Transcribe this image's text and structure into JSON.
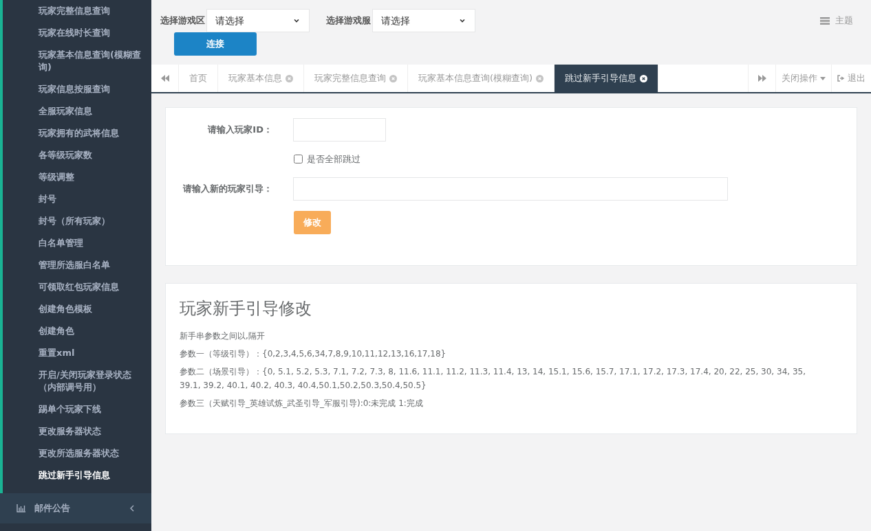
{
  "sidebar": {
    "items": [
      {
        "label": "玩家完整信息查询",
        "selected": false
      },
      {
        "label": "玩家在线时长查询",
        "selected": false
      },
      {
        "label": "玩家基本信息查询(模糊查询)",
        "selected": false
      },
      {
        "label": "玩家信息按服查询",
        "selected": false
      },
      {
        "label": "全服玩家信息",
        "selected": false
      },
      {
        "label": "玩家拥有的武将信息",
        "selected": false
      },
      {
        "label": "各等级玩家数",
        "selected": false
      },
      {
        "label": "等级调整",
        "selected": false
      },
      {
        "label": "封号",
        "selected": false
      },
      {
        "label": "封号（所有玩家）",
        "selected": false
      },
      {
        "label": "白名单管理",
        "selected": false
      },
      {
        "label": "管理所选服白名单",
        "selected": false
      },
      {
        "label": "可领取红包玩家信息",
        "selected": false
      },
      {
        "label": "创建角色模板",
        "selected": false
      },
      {
        "label": "创建角色",
        "selected": false
      },
      {
        "label": "重置xml",
        "selected": false
      },
      {
        "label": "开启/关闭玩家登录状态（内部调号用）",
        "selected": false
      },
      {
        "label": "踢单个玩家下线",
        "selected": false
      },
      {
        "label": "更改服务器状态",
        "selected": false
      },
      {
        "label": "更改所选服务器状态",
        "selected": false
      },
      {
        "label": "跳过新手引导信息",
        "selected": true
      }
    ],
    "section": {
      "label": "邮件公告",
      "expanded": false
    }
  },
  "header": {
    "zone_label": "选择游戏区",
    "zone_value": "请选择",
    "server_label": "选择游戏服",
    "server_value": "请选择",
    "connect_button": "连接",
    "theme": "主题"
  },
  "tabs": [
    {
      "label": "首页",
      "selected": false,
      "closable": false
    },
    {
      "label": "玩家基本信息",
      "selected": false,
      "closable": true
    },
    {
      "label": "玩家完整信息查询",
      "selected": false,
      "closable": true
    },
    {
      "label": "玩家基本信息查询(模糊查询)",
      "selected": false,
      "closable": true
    },
    {
      "label": "跳过新手引导信息",
      "selected": true,
      "closable": true
    }
  ],
  "tab_actions": {
    "close_menu": "关闭操作",
    "logout": "退出"
  },
  "form": {
    "id_label": "请输入玩家ID：",
    "skip_all": {
      "label": "是否全部跳过",
      "checked": false
    },
    "guide_label": "请输入新的玩家引导：",
    "submit": "修改"
  },
  "info": {
    "title": "玩家新手引导修改",
    "lines": [
      "新手串参数之间以,隔开",
      "参数一（等级引导）：{0,2,3,4,5,6,34,7,8,9,10,11,12,13,16,17,18}",
      "参数二（场景引导）：{0, 5.1, 5.2, 5.3, 7.1, 7.2, 7.3, 8, 11.6, 11.1, 11.2, 11.3, 11.4, 13, 14, 15.1, 15.6, 15.7, 17.1, 17.2, 17.3, 17.4, 20, 22, 25, 30, 34, 35, 39.1, 39.2, 40.1, 40.2, 40.3, 40.4,50.1,50.2,50.3,50.4,50.5}",
      "参数三（天赋引导_英雄试炼_武圣引导_军服引导):0:未完成  1:完成"
    ]
  }
}
